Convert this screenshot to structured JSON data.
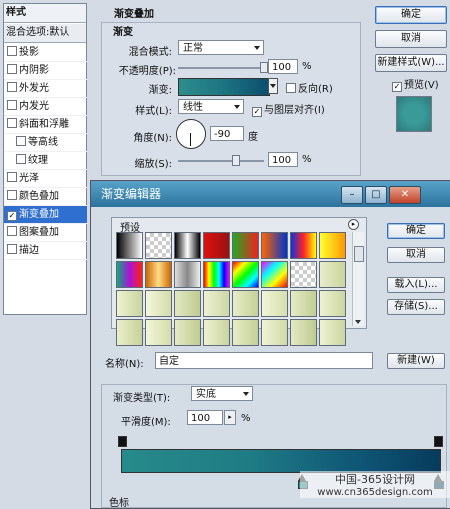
{
  "style_panel": {
    "title": "样式",
    "blending": "混合选项:默认",
    "items": [
      {
        "label": "投影",
        "checked": false,
        "indent": false
      },
      {
        "label": "内阴影",
        "checked": false,
        "indent": false
      },
      {
        "label": "外发光",
        "checked": false,
        "indent": false
      },
      {
        "label": "内发光",
        "checked": false,
        "indent": false
      },
      {
        "label": "斜面和浮雕",
        "checked": false,
        "indent": false
      },
      {
        "label": "等高线",
        "checked": false,
        "indent": true
      },
      {
        "label": "纹理",
        "checked": false,
        "indent": true
      },
      {
        "label": "光泽",
        "checked": false,
        "indent": false
      },
      {
        "label": "颜色叠加",
        "checked": false,
        "indent": false
      },
      {
        "label": "渐变叠加",
        "checked": true,
        "indent": false
      },
      {
        "label": "图案叠加",
        "checked": false,
        "indent": false
      },
      {
        "label": "描边",
        "checked": false,
        "indent": false
      }
    ]
  },
  "overlay": {
    "heading": "渐变叠加",
    "sub_heading": "渐变",
    "blend_mode_label": "混合模式:",
    "blend_mode_value": "正常",
    "opacity_label": "不透明度(P):",
    "opacity_value": "100",
    "opacity_unit": "%",
    "opacity_level": 1.0,
    "gradient_label": "渐变:",
    "reverse_label": "反向(R)",
    "reverse_checked": false,
    "style_label": "样式(L):",
    "style_value": "线性",
    "align_label": "与图层对齐(I)",
    "align_checked": true,
    "angle_label": "角度(N):",
    "angle_value": "-90",
    "angle_unit": "度",
    "scale_label": "缩放(S):",
    "scale_value": "100",
    "scale_unit": "%",
    "scale_level": 0.67
  },
  "right_buttons": {
    "ok": "确定",
    "cancel": "取消",
    "new_style": "新建样式(W)...",
    "preview_label": "预览(V)",
    "preview_checked": true,
    "preview_color": "#3a9a98"
  },
  "editor": {
    "title": "渐变编辑器",
    "presets_label": "预设",
    "ok": "确定",
    "cancel": "取消",
    "load": "载入(L)...",
    "save": "存储(S)...",
    "name_label": "名称(N):",
    "name_value": "自定",
    "new_button": "新建(W)",
    "type_label": "渐变类型(T):",
    "type_value": "实底",
    "smooth_label": "平滑度(M):",
    "smooth_value": "100",
    "smooth_unit": "%",
    "color_stops_label": "色标"
  },
  "watermark": {
    "line1": "中国-365设计网",
    "line2": "www.cn365design.com"
  }
}
